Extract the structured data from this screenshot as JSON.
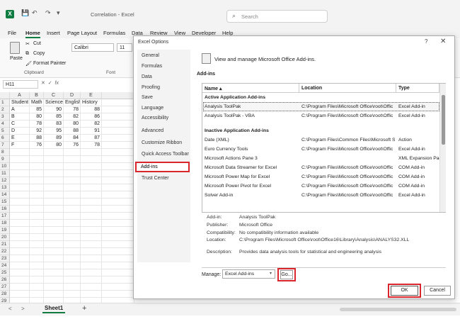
{
  "titlebar": {
    "title": "Correlation - Excel",
    "search_placeholder": "Search",
    "quick_access": [
      "💾",
      "↶",
      "↷",
      "▾"
    ]
  },
  "menu": [
    "File",
    "Home",
    "Insert",
    "Page Layout",
    "Formulas",
    "Data",
    "Review",
    "View",
    "Developer",
    "Help"
  ],
  "ribbon": {
    "paste": "Paste",
    "cut": "Cut",
    "copy": "Copy",
    "format_painter": "Format Painter",
    "clipboard_group": "Clipboard",
    "font_group": "Font",
    "font_name": "Calibri",
    "font_size": "11"
  },
  "formula_bar": {
    "name_box": "H11",
    "fx": "fx",
    "cancel": "✕",
    "enter": "✓"
  },
  "sheet": {
    "columns": [
      "A",
      "B",
      "C",
      "D",
      "E"
    ],
    "rows": [
      [
        "Student",
        "Math",
        "Science",
        "English",
        "History"
      ],
      [
        "A",
        "85",
        "90",
        "78",
        "88"
      ],
      [
        "B",
        "80",
        "85",
        "82",
        "86"
      ],
      [
        "C",
        "78",
        "83",
        "80",
        "82"
      ],
      [
        "D",
        "92",
        "95",
        "88",
        "91"
      ],
      [
        "E",
        "88",
        "89",
        "84",
        "87"
      ],
      [
        "F",
        "76",
        "80",
        "76",
        "78"
      ]
    ],
    "row_count": 29
  },
  "tabs": {
    "sheet": "Sheet1",
    "add": "+",
    "prev": "<",
    "next": ">"
  },
  "dialog": {
    "title": "Excel Options",
    "help": "?",
    "close": "✕",
    "nav": [
      "General",
      "Formulas",
      "Data",
      "Proofing",
      "Save",
      "Language",
      "Accessibility",
      "Advanced",
      "Customize Ribbon",
      "Quick Access Toolbar",
      "Add-ins",
      "Trust Center"
    ],
    "selected_nav": "Add-ins",
    "heading": "View and manage Microsoft Office Add-ins.",
    "section": "Add-ins",
    "table": {
      "headers": [
        "Name ▴",
        "Location",
        "Type"
      ],
      "groups": [
        {
          "label": "Active Application Add-ins",
          "rows": [
            [
              "Analysis ToolPak",
              "C:\\Program Files\\Microsoft Office\\root\\Offic",
              "Excel Add-in"
            ],
            [
              "Analysis ToolPak - VBA",
              "C:\\Program Files\\Microsoft Office\\root\\Offic",
              "Excel Add-in"
            ]
          ]
        },
        {
          "label": "Inactive Application Add-ins",
          "rows": [
            [
              "Date (XML)",
              "C:\\Program Files\\Common Files\\Microsoft S",
              "Action"
            ],
            [
              "Euro Currency Tools",
              "C:\\Program Files\\Microsoft Office\\root\\Offic",
              "Excel Add-in"
            ],
            [
              "Microsoft Actions Pane 3",
              "",
              "XML Expansion Pack"
            ],
            [
              "Microsoft Data Streamer for Excel",
              "C:\\Program Files\\Microsoft Office\\root\\Offic",
              "COM Add-in"
            ],
            [
              "Microsoft Power Map for Excel",
              "C:\\Program Files\\Microsoft Office\\root\\Offic",
              "COM Add-in"
            ],
            [
              "Microsoft Power Pivot for Excel",
              "C:\\Program Files\\Microsoft Office\\root\\Offic",
              "COM Add-in"
            ],
            [
              "Solver Add-in",
              "C:\\Program Files\\Microsoft Office\\root\\Offic",
              "Excel Add-in"
            ]
          ]
        }
      ]
    },
    "details": [
      {
        "label": "Add-in:",
        "value": "Analysis ToolPak"
      },
      {
        "label": "Publisher:",
        "value": "Microsoft Office"
      },
      {
        "label": "Compatibility:",
        "value": "No compatibility information available"
      },
      {
        "label": "Location:",
        "value": "C:\\Program Files\\Microsoft Office\\root\\Office16\\Library\\Analysis\\ANALYS32.XLL"
      },
      {
        "label": "Description:",
        "value": "Provides data analysis tools for statistical and engineering analysis"
      }
    ],
    "manage_label": "Manage:",
    "manage_value": "Excel Add-ins",
    "go": "Go...",
    "ok": "OK",
    "cancel": "Cancel"
  },
  "colors": {
    "excel_green": "#107c41",
    "highlight_red": "#d9262c"
  }
}
